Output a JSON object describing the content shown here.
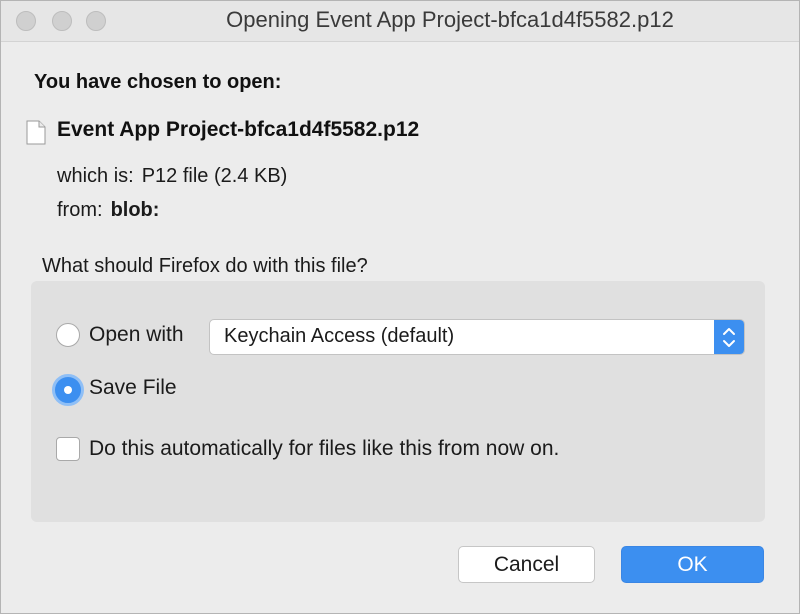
{
  "window": {
    "title": "Opening Event App Project-bfca1d4f5582.p12"
  },
  "dialog": {
    "heading": "You have chosen to open:",
    "file_name": "Event App Project-bfca1d4f5582.p12",
    "which_is_label": "which is:",
    "which_is_value": "P12 file (2.4 KB)",
    "from_label": "from:",
    "from_value": "blob:",
    "question": "What should Firefox do with this file?"
  },
  "options": {
    "open_with_label": "Open with",
    "open_with_selected": false,
    "application_value": "Keychain Access (default)",
    "save_file_label": "Save File",
    "save_file_selected": true,
    "auto_label": "Do this automatically for files like this from now on.",
    "auto_checked": false
  },
  "buttons": {
    "cancel": "Cancel",
    "ok": "OK"
  },
  "colors": {
    "accent": "#3c8ff0",
    "window_bg": "#ececec",
    "group_bg": "#e0e0e0"
  },
  "icons": {
    "file": "document-icon",
    "select_arrows": "chevron-up-down-icon"
  }
}
